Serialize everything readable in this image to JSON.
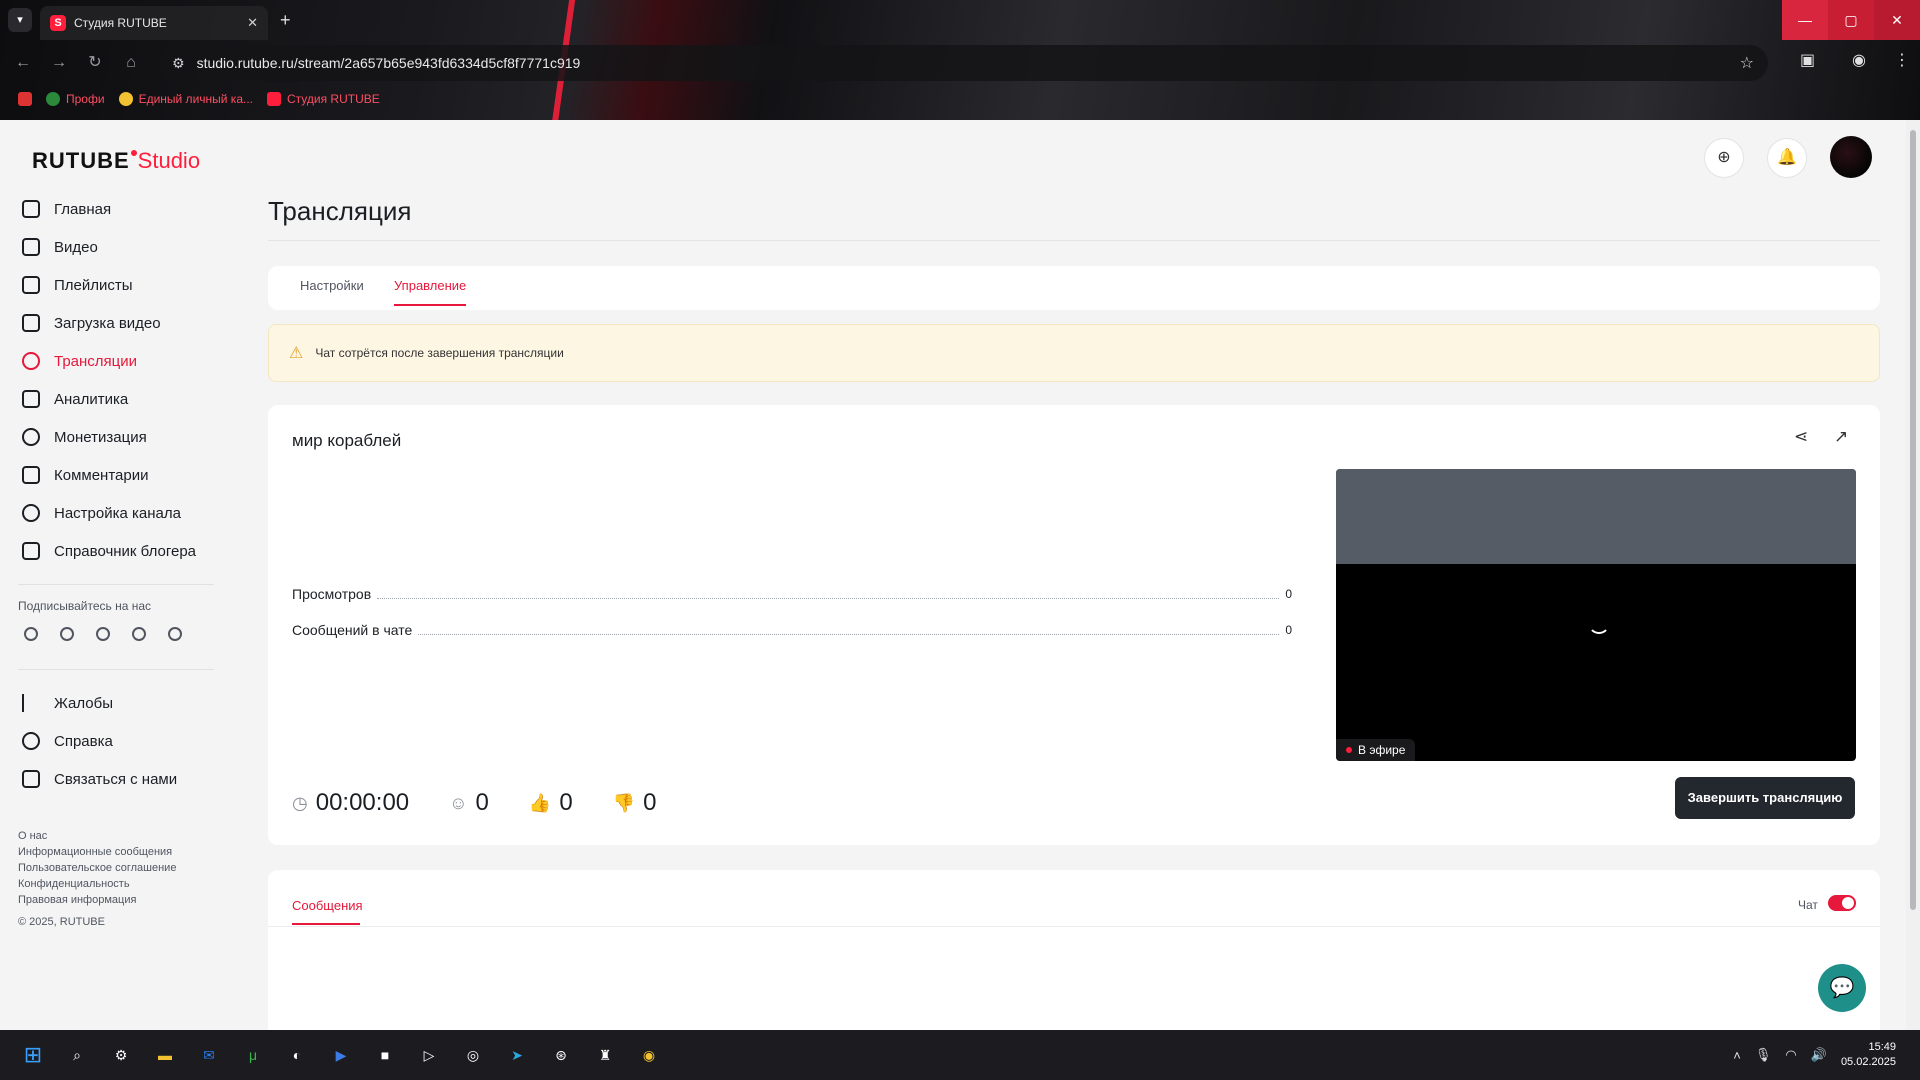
{
  "browser": {
    "tab_title": "Студия RUTUBE",
    "url": "studio.rutube.ru/stream/2a657b65e943fd6334d5cf8f7771c919",
    "bookmarks": [
      "Профи",
      "Единый личный ка...",
      "Студия RUTUBE"
    ]
  },
  "logo": {
    "part1": "RUTUBE",
    "part2": "Studio"
  },
  "sidebar": {
    "items": [
      {
        "label": "Главная"
      },
      {
        "label": "Видео"
      },
      {
        "label": "Плейлисты"
      },
      {
        "label": "Загрузка видео"
      },
      {
        "label": "Трансляции"
      },
      {
        "label": "Аналитика"
      },
      {
        "label": "Монетизация"
      },
      {
        "label": "Комментарии"
      },
      {
        "label": "Настройка канала"
      },
      {
        "label": "Справочник блогера"
      }
    ],
    "follow_label": "Подписывайтесь на нас",
    "bottom_items": [
      {
        "label": "Жалобы"
      },
      {
        "label": "Справка"
      },
      {
        "label": "Связаться с нами"
      }
    ],
    "links": [
      "О нас",
      "Информационные сообщения",
      "Пользовательское соглашение",
      "Конфиденциальность",
      "Правовая информация"
    ],
    "copyright": "© 2025, RUTUBE"
  },
  "page": {
    "title": "Трансляция",
    "tabs": [
      "Настройки",
      "Управление"
    ],
    "warning": "Чат сотрётся после завершения трансляции"
  },
  "stream": {
    "title": "мир кораблей",
    "stats": [
      {
        "label": "Просмотров",
        "value": "0"
      },
      {
        "label": "Сообщений в чате",
        "value": "0"
      }
    ],
    "live_badge": "В эфире",
    "timer": "00:00:00",
    "viewers": "0",
    "likes": "0",
    "dislikes": "0",
    "end_button": "Завершить трансляцию"
  },
  "chat": {
    "tab": "Сообщения",
    "toggle_label": "Чат",
    "enabled": true
  },
  "taskbar": {
    "time": "15:49",
    "date": "05.02.2025"
  },
  "colors": {
    "accent": "#e6183b",
    "warn_bg": "#fdf6e3",
    "dark_button": "#23272e"
  }
}
